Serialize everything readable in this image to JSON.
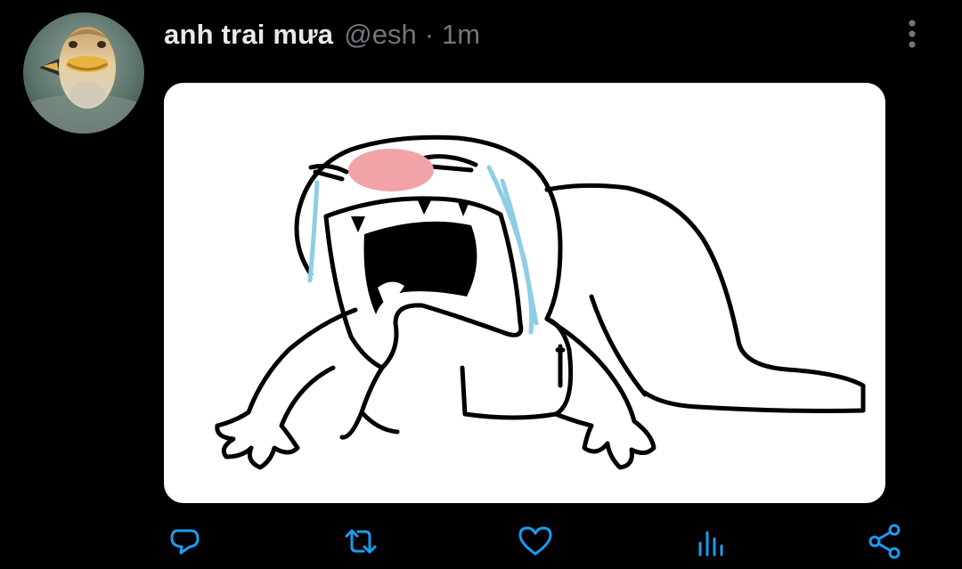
{
  "tweet": {
    "display_name": "anh trai mưa",
    "handle": "@esh",
    "separator": "·",
    "time": "1m"
  },
  "icons": {
    "avatar": "fish-avatar",
    "more": "more-vertical-icon",
    "reply": "reply-icon",
    "retweet": "retweet-icon",
    "like": "heart-icon",
    "analytics": "analytics-icon",
    "share": "share-icon"
  },
  "colors": {
    "background": "#000000",
    "name": "#e7e9ea",
    "secondary": "#71767b",
    "action_icon": "#1d9bf0",
    "tears": "#8fcde6",
    "blush": "#f2a3a7"
  }
}
